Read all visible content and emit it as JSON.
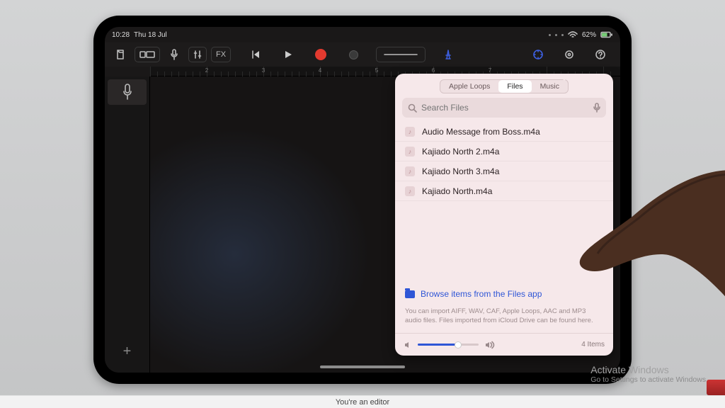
{
  "status": {
    "time": "10:28",
    "date": "Thu 18 Jul",
    "battery": "62%"
  },
  "toolbar": {
    "fx_label": "FX",
    "timecode": "",
    "metronome": "△"
  },
  "popover": {
    "tabs": [
      "Apple Loops",
      "Files",
      "Music"
    ],
    "active_tab": "Files",
    "search_placeholder": "Search Files",
    "files": [
      "Audio Message from Boss.m4a",
      "Kajiado North 2.m4a",
      "Kajiado North 3.m4a",
      "Kajiado North.m4a"
    ],
    "browse_label": "Browse items from the Files app",
    "hint": "You can import AIFF, WAV, CAF, Apple Loops, AAC and MP3 audio files. Files imported from iCloud Drive can be found here.",
    "item_count": "4 Items"
  },
  "watermark": {
    "title": "Activate Windows",
    "sub": "Go to Settings to activate Windows."
  },
  "caption": "You're an editor"
}
